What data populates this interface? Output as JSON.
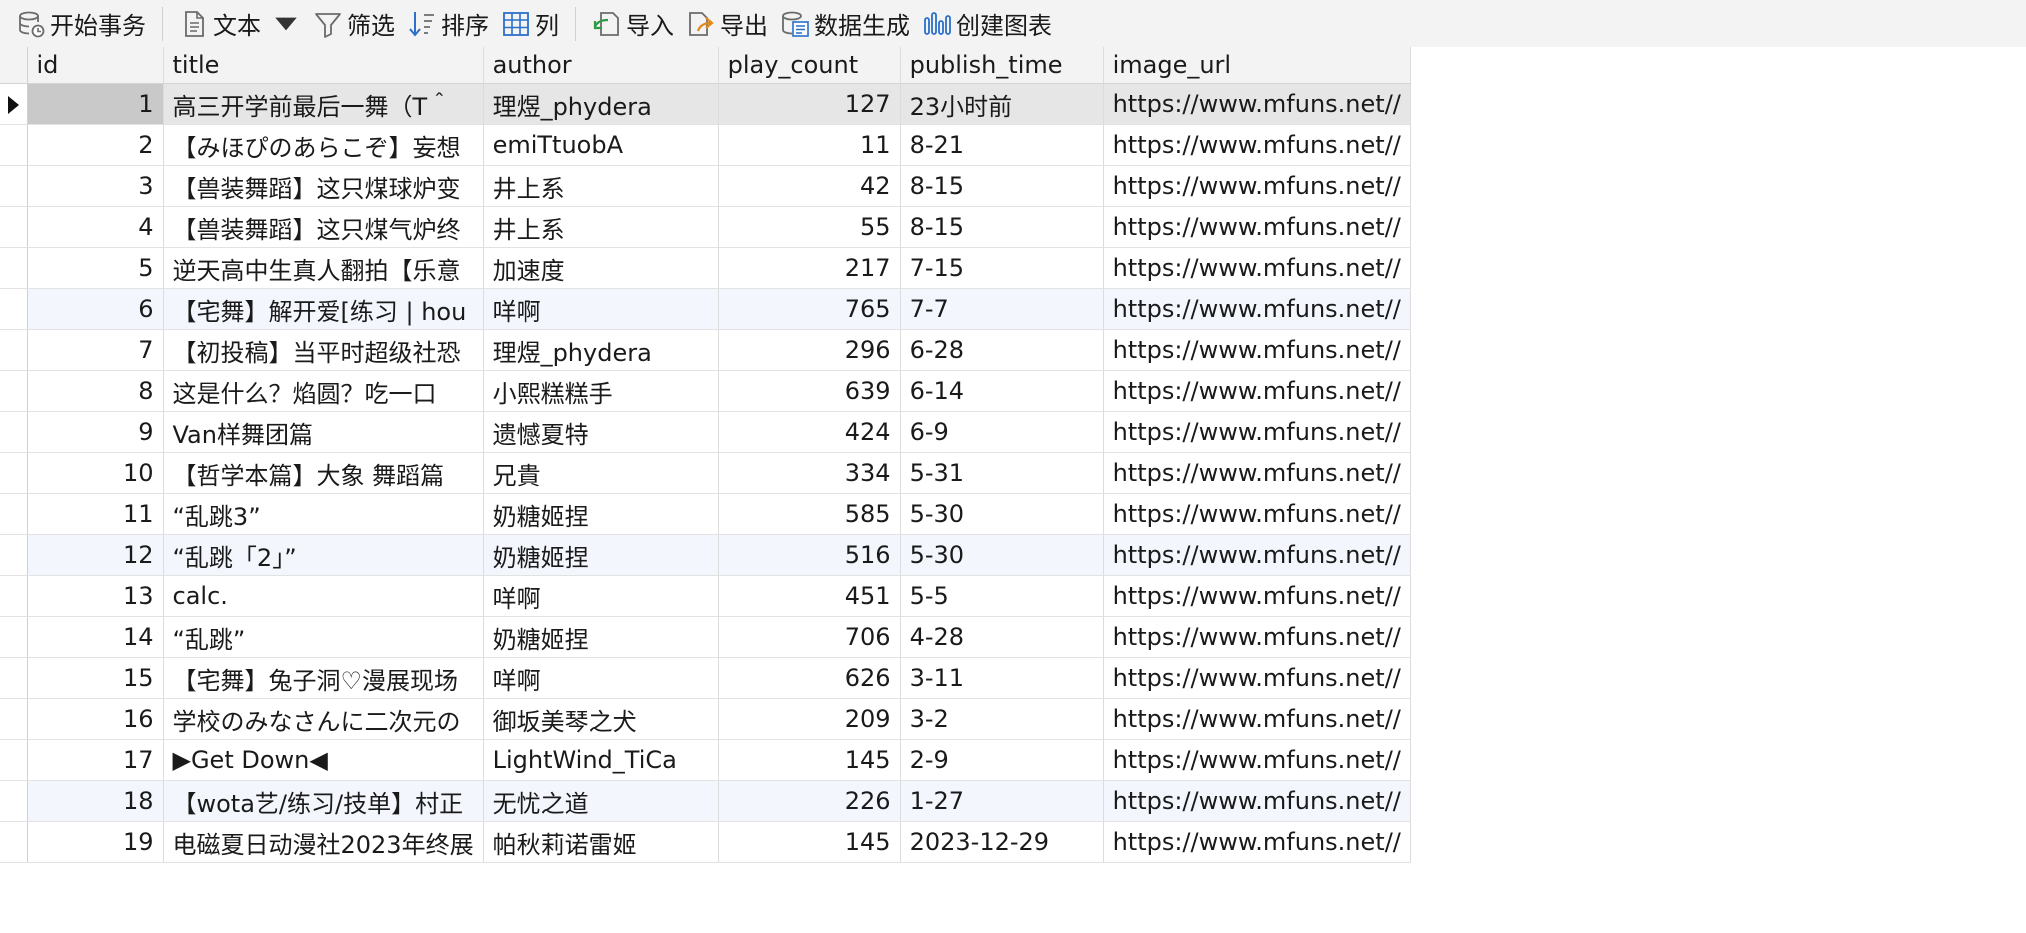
{
  "toolbar": {
    "begin_transaction": "开始事务",
    "text": "文本",
    "filter": "筛选",
    "sort": "排序",
    "columns": "列",
    "import": "导入",
    "export": "导出",
    "generate_data": "数据生成",
    "create_chart": "创建图表"
  },
  "colors": {
    "accent": "#2b6fc9",
    "selected_row": "#e6e6e6",
    "alt_row": "#f3f7fd",
    "toolbar_bg": "#f3f3f3"
  },
  "table": {
    "columns": [
      "id",
      "title",
      "author",
      "play_count",
      "publish_time",
      "image_url"
    ],
    "rows": [
      {
        "id": "1",
        "title": "高三开学前最后一舞（T＾",
        "author": "理煜_phydera",
        "play_count": "127",
        "publish_time": "23小时前",
        "image_url": "https://www.mfuns.net//"
      },
      {
        "id": "2",
        "title": "【みほぴのあらこぞ】妄想",
        "author": "emiTtuobA",
        "play_count": "11",
        "publish_time": "8-21",
        "image_url": "https://www.mfuns.net//"
      },
      {
        "id": "3",
        "title": "【兽装舞蹈】这只煤球炉变",
        "author": "井上系",
        "play_count": "42",
        "publish_time": "8-15",
        "image_url": "https://www.mfuns.net//"
      },
      {
        "id": "4",
        "title": "【兽装舞蹈】这只煤气炉终",
        "author": "井上系",
        "play_count": "55",
        "publish_time": "8-15",
        "image_url": "https://www.mfuns.net//"
      },
      {
        "id": "5",
        "title": "逆天高中生真人翻拍【乐意",
        "author": "加速度",
        "play_count": "217",
        "publish_time": "7-15",
        "image_url": "https://www.mfuns.net//"
      },
      {
        "id": "6",
        "title": "【宅舞】解开爱[练习 | hou",
        "author": "咩啊",
        "play_count": "765",
        "publish_time": "7-7",
        "image_url": "https://www.mfuns.net//"
      },
      {
        "id": "7",
        "title": "【初投稿】当平时超级社恐",
        "author": "理煜_phydera",
        "play_count": "296",
        "publish_time": "6-28",
        "image_url": "https://www.mfuns.net//"
      },
      {
        "id": "8",
        "title": "这是什么？焰圆？吃一口",
        "author": "小熙糕糕手",
        "play_count": "639",
        "publish_time": "6-14",
        "image_url": "https://www.mfuns.net//"
      },
      {
        "id": "9",
        "title": "Van样舞团篇",
        "author": "遗憾夏特",
        "play_count": "424",
        "publish_time": "6-9",
        "image_url": "https://www.mfuns.net//"
      },
      {
        "id": "10",
        "title": "【哲学本篇】大象 舞蹈篇",
        "author": "兄貴",
        "play_count": "334",
        "publish_time": "5-31",
        "image_url": "https://www.mfuns.net//"
      },
      {
        "id": "11",
        "title": "“乱跳3”",
        "author": "奶糖姬捏",
        "play_count": "585",
        "publish_time": "5-30",
        "image_url": "https://www.mfuns.net//"
      },
      {
        "id": "12",
        "title": "“乱跳「2」”",
        "author": "奶糖姬捏",
        "play_count": "516",
        "publish_time": "5-30",
        "image_url": "https://www.mfuns.net//"
      },
      {
        "id": "13",
        "title": "calc.",
        "author": "咩啊",
        "play_count": "451",
        "publish_time": "5-5",
        "image_url": "https://www.mfuns.net//"
      },
      {
        "id": "14",
        "title": "“乱跳”",
        "author": "奶糖姬捏",
        "play_count": "706",
        "publish_time": "4-28",
        "image_url": "https://www.mfuns.net//"
      },
      {
        "id": "15",
        "title": "【宅舞】兔子洞♡漫展现场",
        "author": "咩啊",
        "play_count": "626",
        "publish_time": "3-11",
        "image_url": "https://www.mfuns.net//"
      },
      {
        "id": "16",
        "title": "学校のみなさんに二次元の",
        "author": "御坂美琴之犬",
        "play_count": "209",
        "publish_time": "3-2",
        "image_url": "https://www.mfuns.net//"
      },
      {
        "id": "17",
        "title": "▶Get Down◀",
        "author": "LightWind_TiCa",
        "play_count": "145",
        "publish_time": "2-9",
        "image_url": "https://www.mfuns.net//"
      },
      {
        "id": "18",
        "title": "【wota艺/练习/技单】村正",
        "author": "无忧之道",
        "play_count": "226",
        "publish_time": "1-27",
        "image_url": "https://www.mfuns.net//"
      },
      {
        "id": "19",
        "title": "电磁夏日动漫社2023年终展",
        "author": "帕秋莉诺雷姬",
        "play_count": "145",
        "publish_time": "2023-12-29",
        "image_url": "https://www.mfuns.net//"
      }
    ]
  }
}
